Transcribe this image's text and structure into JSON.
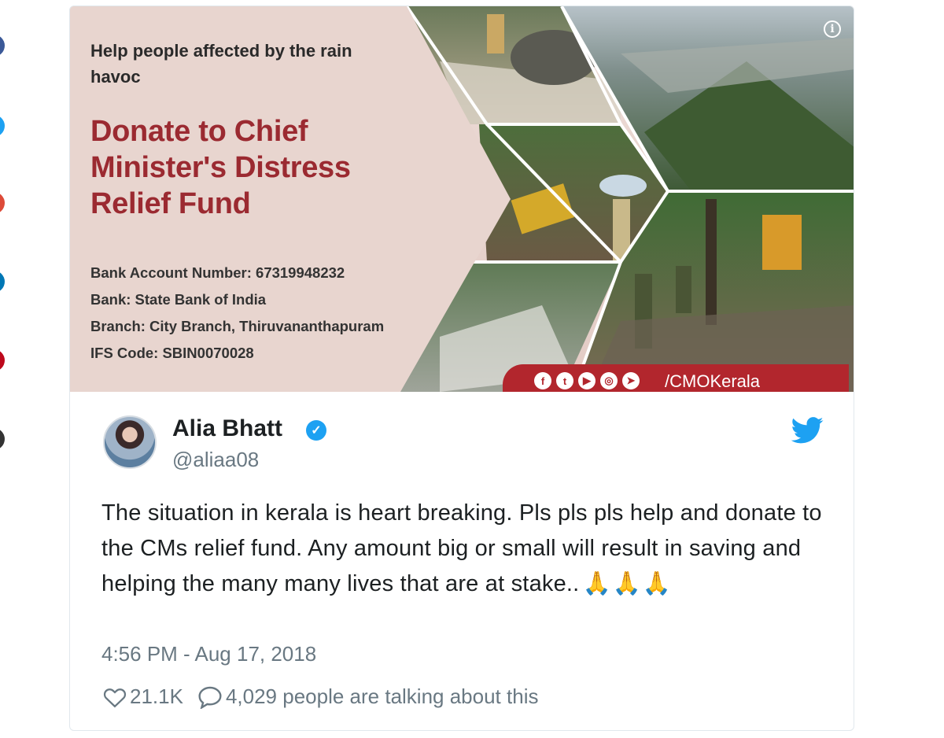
{
  "share_bar": {
    "colors": [
      "#3b5998",
      "#1da1f2",
      "#dd4b39",
      "#0077b5",
      "#bd081c",
      "#333333"
    ]
  },
  "banner": {
    "subtitle": "Help people affected by the rain havoc",
    "title": "Donate to Chief Minister's Distress Relief Fund",
    "info_lines": [
      "Bank Account Number:  67319948232",
      "Bank: State Bank of India",
      "Branch: City Branch, Thiruvananthapuram",
      "IFS Code: SBIN0070028"
    ],
    "handle": "/CMOKerala",
    "social_icons": [
      "facebook-icon",
      "twitter-icon",
      "youtube-icon",
      "instagram-icon",
      "telegram-icon"
    ],
    "info_icon": "i",
    "colors": {
      "title": "#9b2a31",
      "bar": "#b2262d"
    }
  },
  "tweet": {
    "author_name": "Alia Bhatt",
    "author_handle": "@aliaa08",
    "verified": true,
    "text": "The situation in kerala is heart breaking. Pls pls pls help and donate to the CMs relief fund. Any amount big or small will result in saving and helping the many many lives that are at stake..",
    "emoji": "🙏🙏🙏",
    "timestamp": "4:56 PM - Aug 17, 2018",
    "likes": "21.1K",
    "talking": "4,029 people are talking about this",
    "colors": {
      "accent": "#1da1f2",
      "muted": "#697882",
      "text": "#1c2022"
    }
  }
}
